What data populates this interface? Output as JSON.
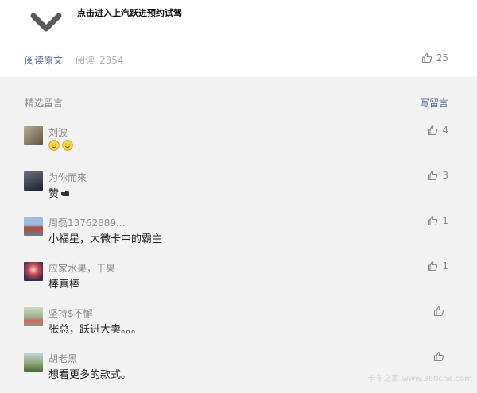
{
  "header": {
    "banner_text": "点击进入上汽跃进预约试驾",
    "read_original": "阅读原文",
    "read_label": "阅读",
    "read_count": "2354",
    "like_count": "25"
  },
  "comments_section": {
    "title": "精选留言",
    "write_label": "写留言"
  },
  "comments": [
    {
      "nickname": "刘波",
      "text": "",
      "emoji": [
        "smiley",
        "smiley"
      ],
      "likes": "4",
      "avatar_color": "#8a7f63"
    },
    {
      "nickname": "为你而来",
      "text": "赞",
      "emoji": [
        "pointing-hand"
      ],
      "likes": "3",
      "avatar_color": "#3b3e4a"
    },
    {
      "nickname": "周磊13762889...",
      "text": "小福星，大微卡中的霸主",
      "emoji": [],
      "likes": "1",
      "avatar_color": "#8aa6c9"
    },
    {
      "nickname": "应家水果，干果",
      "text": "棒真棒",
      "emoji": [],
      "likes": "1",
      "avatar_color": "#5b4a66"
    },
    {
      "nickname": "坚持$不懈",
      "text": "张总，跃进大卖。。。",
      "emoji": [],
      "likes": "",
      "avatar_color": "#a6b8a0"
    },
    {
      "nickname": "胡老黑",
      "text": "想看更多的款式。",
      "emoji": [],
      "likes": "",
      "avatar_color": "#6f8a55"
    }
  ],
  "watermark": "卡车之家 www.360che.com",
  "icons": {
    "collapse": "chevron-down-icon",
    "like": "thumb-up-icon"
  }
}
